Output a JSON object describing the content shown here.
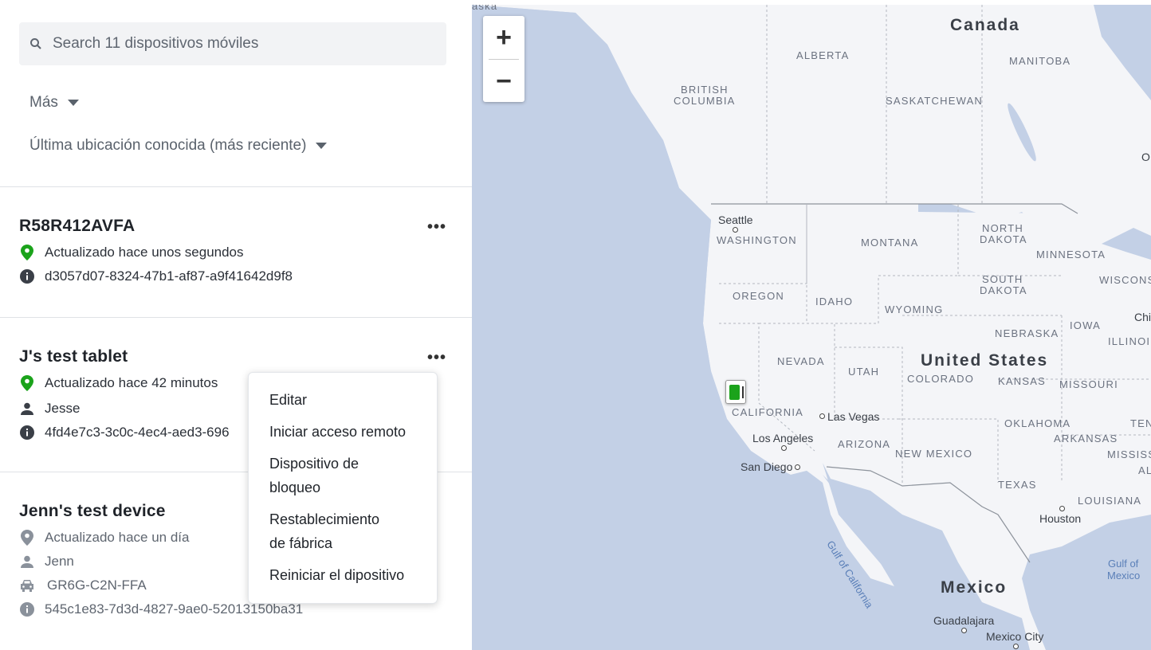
{
  "search": {
    "placeholder": "Search 11 dispositivos móviles"
  },
  "filters": {
    "more_label": "Más",
    "sort_label": "Última ubicación conocida (más reciente)"
  },
  "devices": [
    {
      "name": "R58R412AVFA",
      "updated": "Actualizado hace unos segundos",
      "id": "d3057d07-8324-47b1-af87-a9f41642d9f8"
    },
    {
      "name": "J's test tablet",
      "updated": "Actualizado hace 42 minutos",
      "user": "Jesse",
      "id": "4fd4e7c3-3c0c-4ec4-aed3-696"
    },
    {
      "name": "Jenn's test device",
      "updated": "Actualizado hace un día",
      "user": "Jenn",
      "vehicle": "GR6G-C2N-FFA",
      "id": "545c1e83-7d3d-4827-9ae0-52013150ba31"
    }
  ],
  "more_button": "•••",
  "context_menu": {
    "items": [
      "Editar",
      "Iniciar acceso remoto",
      "Dispositivo de bloqueo",
      "Restablecimiento de fábrica",
      "Reiniciar el dipositivo"
    ]
  },
  "map": {
    "zoom_in": "+",
    "zoom_out": "−",
    "countries": [
      "Canada",
      "United States",
      "Mexico"
    ],
    "regions": [
      "ALBERTA",
      "MANITOBA",
      "BRITISH",
      "COLUMBIA",
      "SASKATCHEWAN",
      "WASHINGTON",
      "MONTANA",
      "NORTH",
      "DAKOTA",
      "MINNESOTA",
      "OREGON",
      "IDAHO",
      "WYOMING",
      "SOUTH",
      "DAKOTA",
      "WISCONS",
      "IOWA",
      "NEBRASKA",
      "ILLINOI",
      "NEVADA",
      "UTAH",
      "COLORADO",
      "KANSAS",
      "MISSOURI",
      "CALIFORNIA",
      "OKLAHOMA",
      "TEN",
      "ARIZONA",
      "NEW MEXICO",
      "ARKANSAS",
      "MISSISSIP",
      "AL",
      "TEXAS",
      "LOUISIANA",
      "aska"
    ],
    "cities": [
      "Seattle",
      "Las Vegas",
      "Los Angeles",
      "San Diego",
      "Houston",
      "Guadalajara",
      "Mexico City",
      "Chi",
      "O"
    ],
    "water": [
      "Gulf of California",
      "Gulf of",
      "Mexico"
    ],
    "colors": {
      "water": "#c3d0e6",
      "land": "#f4f5f8",
      "marker": "#1ba31b"
    }
  }
}
